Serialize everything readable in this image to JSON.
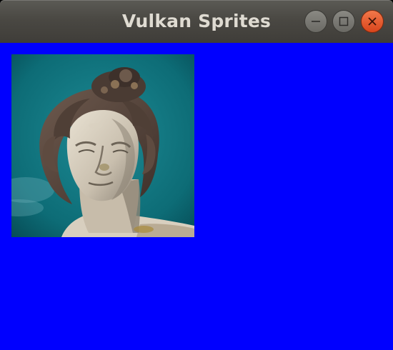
{
  "window": {
    "title": "Vulkan Sprites",
    "background_color": "#0000ff",
    "controls": {
      "minimize_icon": "minimize-icon",
      "maximize_icon": "maximize-icon",
      "close_icon": "close-icon",
      "close_color": "#e95420"
    }
  },
  "sprites": [
    {
      "description_icon": "statue-head-photo"
    }
  ]
}
